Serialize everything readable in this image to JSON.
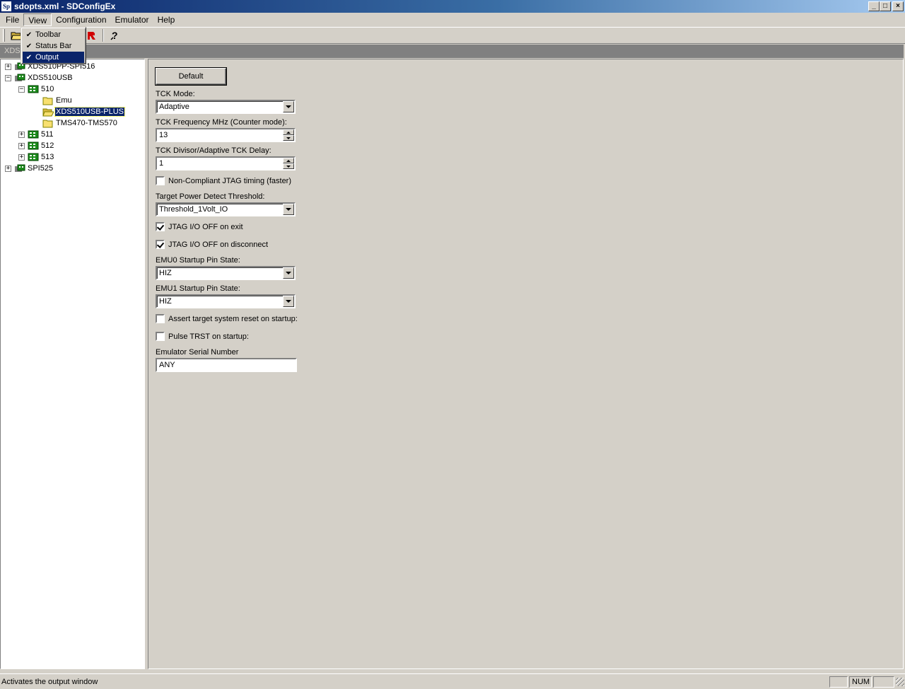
{
  "window": {
    "title": "sdopts.xml - SDConfigEx",
    "icon_text": "Sp",
    "minimize": "_",
    "maximize": "□",
    "close": "×"
  },
  "menubar": {
    "items": [
      "File",
      "View",
      "Configuration",
      "Emulator",
      "Help"
    ]
  },
  "view_menu": {
    "items": [
      {
        "label": "Toolbar",
        "checked": true
      },
      {
        "label": "Status Bar",
        "checked": true
      },
      {
        "label": "Output",
        "checked": true
      }
    ],
    "check_glyph": "✔"
  },
  "toolbar": {
    "icons": [
      "open-folder-icon",
      "red-arrow-icon",
      "help-icon"
    ],
    "help_glyph": "?"
  },
  "band": {
    "label": "XDS"
  },
  "tree": {
    "nodes": [
      {
        "label": "XDS510PP-SPI516",
        "expander": "+"
      },
      {
        "label": "XDS510USB",
        "expander": "−"
      },
      {
        "label": "510",
        "expander": "−"
      },
      {
        "label": "Emu"
      },
      {
        "label": "XDS510USB-PLUS",
        "selected": true
      },
      {
        "label": "TMS470-TMS570"
      },
      {
        "label": "511",
        "expander": "+"
      },
      {
        "label": "512",
        "expander": "+"
      },
      {
        "label": "513",
        "expander": "+"
      },
      {
        "label": "SPI525",
        "expander": "+"
      }
    ]
  },
  "settings": {
    "default_button": "Default",
    "tck_mode_label": "TCK Mode:",
    "tck_mode_value": "Adaptive",
    "tck_freq_label": "TCK Frequency MHz (Counter mode):",
    "tck_freq_value": "13",
    "tck_divisor_label": "TCK Divisor/Adaptive TCK Delay:",
    "tck_divisor_value": "1",
    "noncompliant_label": "Non-Compliant JTAG timing (faster)",
    "noncompliant_checked": false,
    "power_threshold_label": "Target Power Detect Threshold:",
    "power_threshold_value": "Threshold_1Volt_IO",
    "jtag_off_exit_label": "JTAG I/O OFF on exit",
    "jtag_off_exit_checked": true,
    "jtag_off_disconnect_label": "JTAG I/O OFF on disconnect",
    "jtag_off_disconnect_checked": true,
    "emu0_label": "EMU0 Startup Pin State:",
    "emu0_value": "HIZ",
    "emu1_label": "EMU1 Startup Pin State:",
    "emu1_value": "HIZ",
    "assert_reset_label": "Assert target system reset on startup:",
    "assert_reset_checked": false,
    "pulse_trst_label": "Pulse TRST on startup:",
    "pulse_trst_checked": false,
    "serial_label": "Emulator Serial Number",
    "serial_value": "ANY"
  },
  "statusbar": {
    "message": "Activates the output window",
    "num": "NUM"
  }
}
